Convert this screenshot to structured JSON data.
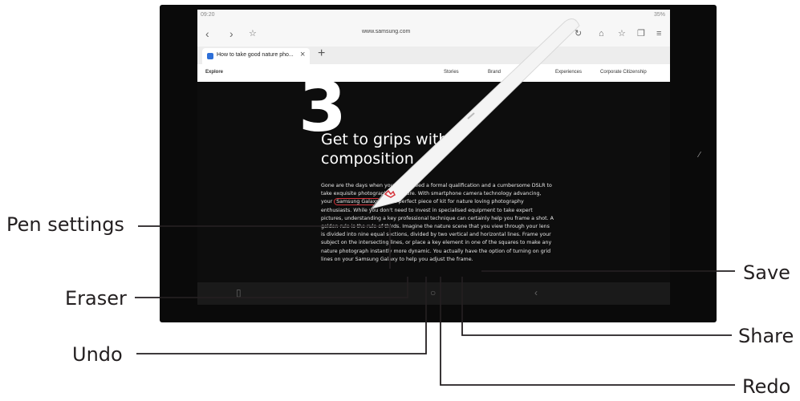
{
  "callouts": {
    "pen_settings": "Pen settings",
    "eraser": "Eraser",
    "undo": "Undo",
    "share": "Share",
    "redo": "Redo",
    "save": "Save"
  },
  "status_bar": {
    "time": "09:20",
    "battery": "35%"
  },
  "browser": {
    "url": "www.samsung.com",
    "tab_title": "How to take good nature pho...",
    "tab_close": "×",
    "new_tab": "+"
  },
  "site_nav": {
    "section": "Explore",
    "items": [
      "Stories",
      "Brand",
      "Experiences",
      "Corporate Citizenship"
    ]
  },
  "article": {
    "number": "3",
    "heading": "Get to grips with composition",
    "body_before": "Gone are the days when you would need a formal qualification and a cumbersome DSLR to take exquisite photographs of nature. With smartphone camera technology advancing, your ",
    "highlight": "Samsung Galaxy",
    "body_after": " is the perfect piece of kit for nature loving photography enthusiasts. While you don't need to invest in specialised equipment to take expert pictures, understanding a key professional technique can certainly help you frame a shot. A golden rule is the rule of thirds. Imagine the nature scene that you view through your lens is divided into nine equal sections, divided by two vertical and horizontal lines. Frame your subject on the intersecting lines, or place a key element in one of the squares to make any nature photograph instantly more dynamic. You actually have the option of turning on grid lines on your Samsung Galaxy to help you adjust the frame."
  },
  "colors": {
    "annotation": "#d6343b",
    "toolbar": "#3b3b3b",
    "callout_line": "#231f20"
  }
}
